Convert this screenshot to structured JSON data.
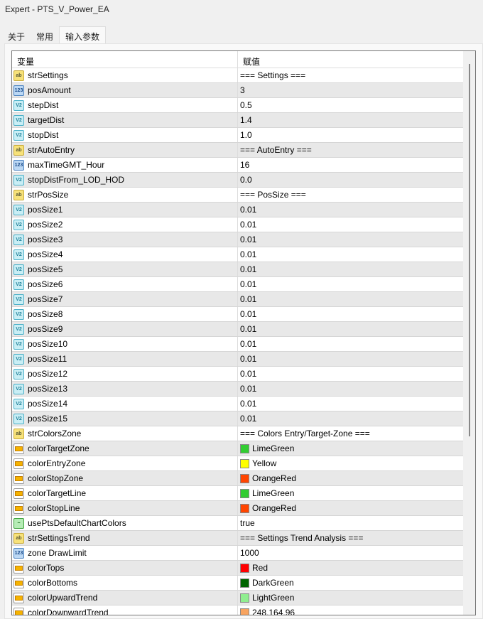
{
  "window": {
    "title": "Expert - PTS_V_Power_EA"
  },
  "tabs": [
    {
      "label": "关于"
    },
    {
      "label": "常用"
    },
    {
      "label": "输入参数",
      "active": true
    }
  ],
  "table": {
    "headers": [
      "变量",
      "赋值"
    ],
    "rows": [
      {
        "icon": "ab",
        "name": "strSettings",
        "value": "=== Settings ==="
      },
      {
        "icon": "num",
        "name": "posAmount",
        "value": "3"
      },
      {
        "icon": "dbl",
        "name": "stepDist",
        "value": "0.5"
      },
      {
        "icon": "dbl",
        "name": "targetDist",
        "value": "1.4"
      },
      {
        "icon": "dbl",
        "name": "stopDist",
        "value": "1.0"
      },
      {
        "icon": "ab",
        "name": "strAutoEntry",
        "value": "=== AutoEntry ==="
      },
      {
        "icon": "num",
        "name": "maxTimeGMT_Hour",
        "value": "16"
      },
      {
        "icon": "dbl",
        "name": "stopDistFrom_LOD_HOD",
        "value": "0.0"
      },
      {
        "icon": "ab",
        "name": "strPosSize",
        "value": "=== PosSize ==="
      },
      {
        "icon": "dbl",
        "name": "posSize1",
        "value": "0.01"
      },
      {
        "icon": "dbl",
        "name": "posSize2",
        "value": "0.01"
      },
      {
        "icon": "dbl",
        "name": "posSize3",
        "value": "0.01"
      },
      {
        "icon": "dbl",
        "name": "posSize4",
        "value": "0.01"
      },
      {
        "icon": "dbl",
        "name": "posSize5",
        "value": "0.01"
      },
      {
        "icon": "dbl",
        "name": "posSize6",
        "value": "0.01"
      },
      {
        "icon": "dbl",
        "name": "posSize7",
        "value": "0.01"
      },
      {
        "icon": "dbl",
        "name": "posSize8",
        "value": "0.01"
      },
      {
        "icon": "dbl",
        "name": "posSize9",
        "value": "0.01"
      },
      {
        "icon": "dbl",
        "name": "posSize10",
        "value": "0.01"
      },
      {
        "icon": "dbl",
        "name": "posSize11",
        "value": "0.01"
      },
      {
        "icon": "dbl",
        "name": "posSize12",
        "value": "0.01"
      },
      {
        "icon": "dbl",
        "name": "posSize13",
        "value": "0.01"
      },
      {
        "icon": "dbl",
        "name": "posSize14",
        "value": "0.01"
      },
      {
        "icon": "dbl",
        "name": "posSize15",
        "value": "0.01"
      },
      {
        "icon": "ab",
        "name": "strColorsZone",
        "value": "=== Colors Entry/Target-Zone ==="
      },
      {
        "icon": "color",
        "name": "colorTargetZone",
        "value": "LimeGreen",
        "swatch": "#32cd32"
      },
      {
        "icon": "color",
        "name": "colorEntryZone",
        "value": "Yellow",
        "swatch": "#ffff00"
      },
      {
        "icon": "color",
        "name": "colorStopZone",
        "value": "OrangeRed",
        "swatch": "#ff4500"
      },
      {
        "icon": "color",
        "name": "colorTargetLine",
        "value": "LimeGreen",
        "swatch": "#32cd32"
      },
      {
        "icon": "color",
        "name": "colorStopLine",
        "value": "OrangeRed",
        "swatch": "#ff4500"
      },
      {
        "icon": "bool",
        "name": "usePtsDefaultChartColors",
        "value": "true"
      },
      {
        "icon": "ab",
        "name": "strSettingsTrend",
        "value": "=== Settings Trend Analysis ==="
      },
      {
        "icon": "num",
        "name": "zone DrawLimit",
        "value": "1000"
      },
      {
        "icon": "color",
        "name": "colorTops",
        "value": "Red",
        "swatch": "#ff0000"
      },
      {
        "icon": "color",
        "name": "colorBottoms",
        "value": "DarkGreen",
        "swatch": "#006400"
      },
      {
        "icon": "color",
        "name": "colorUpwardTrend",
        "value": "LightGreen",
        "swatch": "#90ee90"
      },
      {
        "icon": "color",
        "name": "colorDownwardTrend",
        "value": "248,164,96",
        "swatch": "#f8a460"
      }
    ]
  },
  "icons": {
    "ab": "ab",
    "num": "123",
    "dbl": "V2",
    "bool": "~"
  }
}
